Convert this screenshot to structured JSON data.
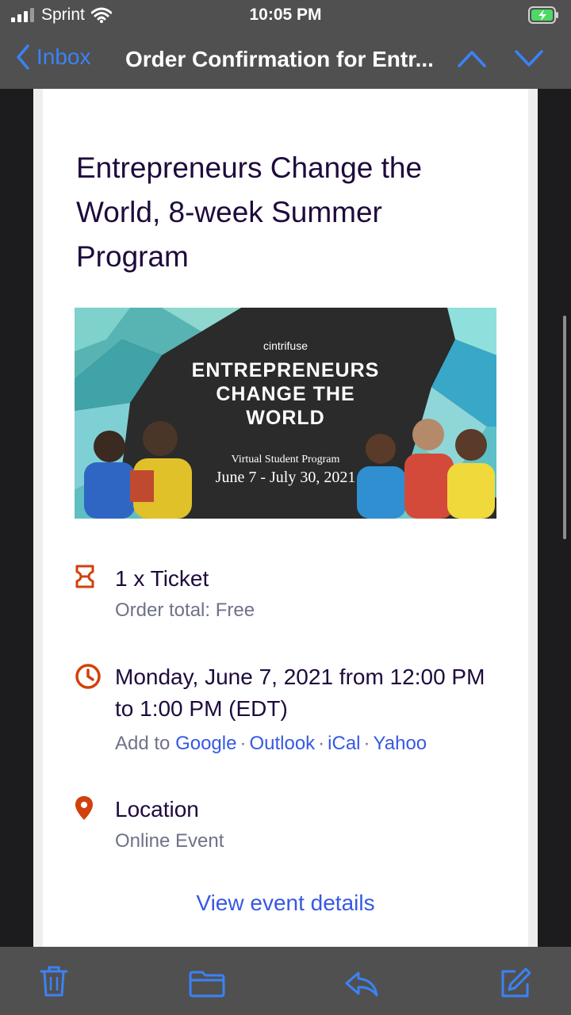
{
  "status_bar": {
    "carrier": "Sprint",
    "time": "10:05 PM"
  },
  "nav": {
    "back_label": "Inbox",
    "title": "Order Confirmation for Entr..."
  },
  "email": {
    "heading": "Entrepreneurs Change the World, 8-week Summer Program",
    "banner": {
      "brand": "cintrifuse",
      "headline_lines": [
        "ENTREPRENEURS",
        "CHANGE THE",
        "WORLD"
      ],
      "subtitle": "Virtual Student Program",
      "dates": "June 7 - July 30, 2021"
    },
    "ticket": {
      "title": "1 x Ticket",
      "total": "Order total: Free"
    },
    "datetime": {
      "text": "Monday, June 7, 2021 from 12:00 PM to 1:00 PM (EDT)",
      "add_to_label": "Add to",
      "calendars": [
        "Google",
        "Outlook",
        "iCal",
        "Yahoo"
      ]
    },
    "location": {
      "title": "Location",
      "value": "Online Event"
    },
    "cta": "View event details"
  },
  "colors": {
    "accent": "#3b82f6",
    "eventbrite_orange": "#d1410c",
    "heading": "#1e0a3c",
    "link": "#3659e3"
  },
  "icons": [
    "signal-icon",
    "wifi-icon",
    "battery-icon",
    "chevron-left-icon",
    "chevron-up-icon",
    "chevron-down-icon",
    "ticket-icon",
    "clock-icon",
    "location-pin-icon",
    "trash-icon",
    "folder-icon",
    "reply-icon",
    "compose-icon"
  ]
}
